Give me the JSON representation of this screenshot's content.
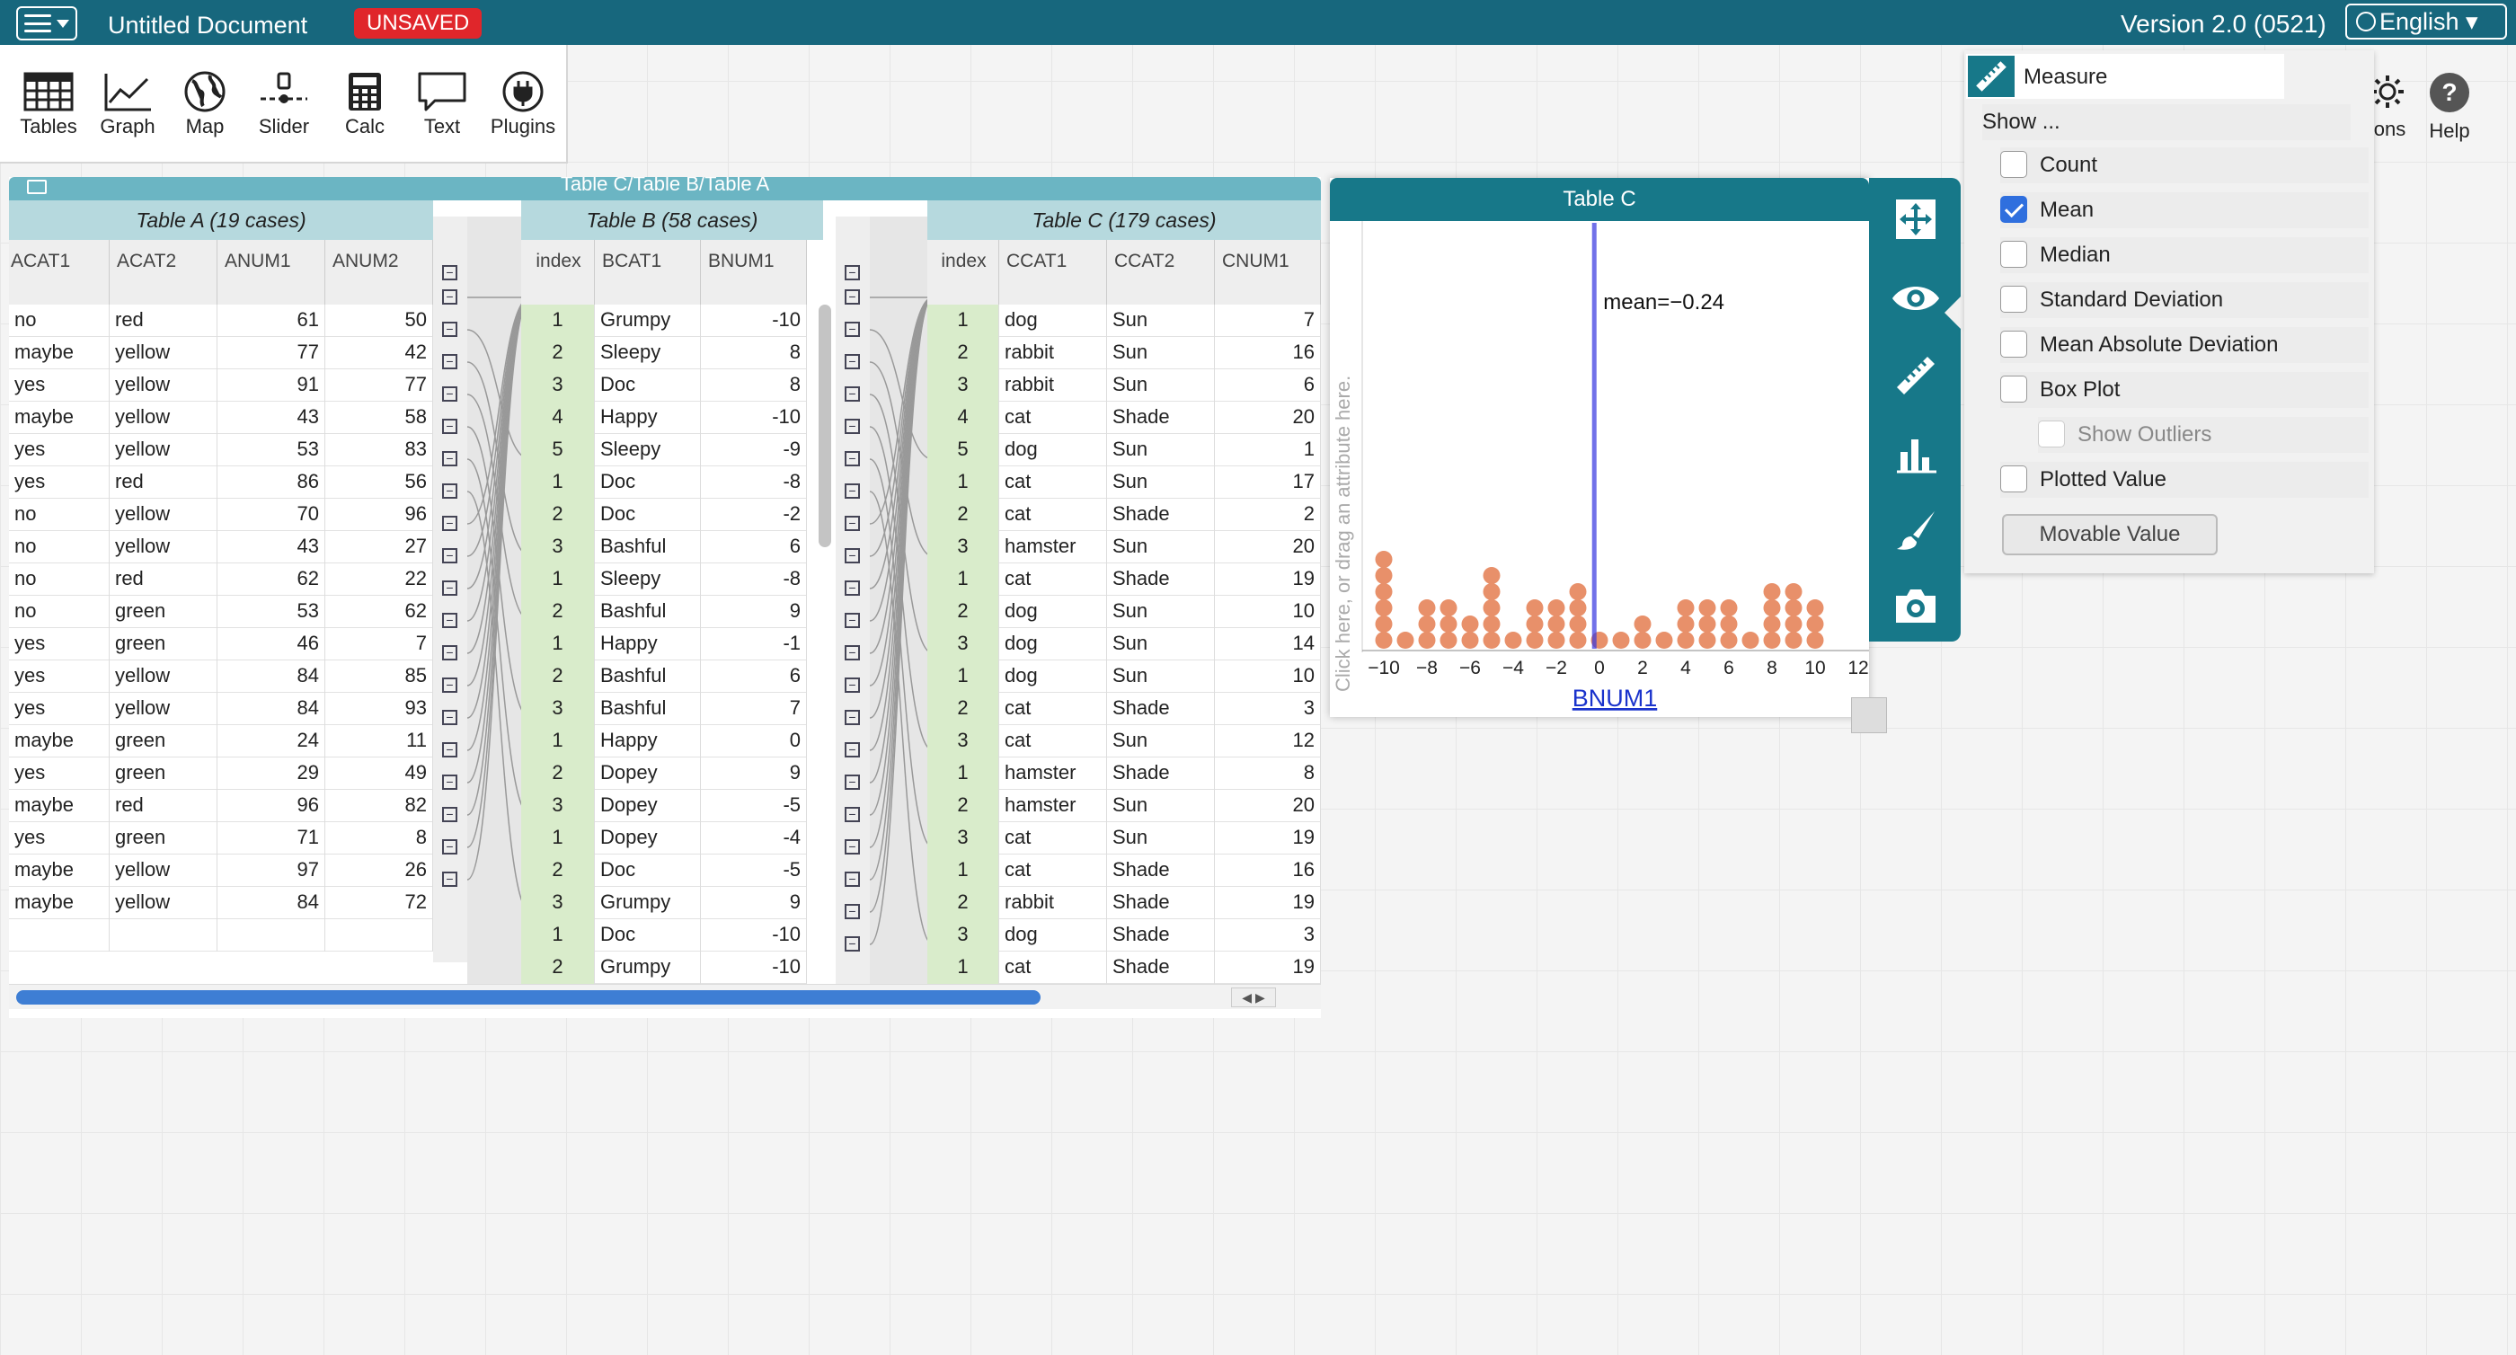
{
  "app": {
    "document_title": "Untitled Document",
    "unsaved_badge": "UNSAVED",
    "version": "Version 2.0 (0521)",
    "language": "English ▾"
  },
  "toolbar": {
    "tables": "Tables",
    "graph": "Graph",
    "map": "Map",
    "slider": "Slider",
    "calc": "Calc",
    "text": "Text",
    "plugins": "Plugins",
    "options": "tions",
    "help": "Help"
  },
  "tables": {
    "window_title": "Table C/Table B/Table A",
    "table_a": {
      "title": "Table A (19 cases)",
      "columns": [
        "ACAT1",
        "ACAT2",
        "ANUM1",
        "ANUM2"
      ],
      "rows": [
        [
          "no",
          "red",
          "61",
          "50"
        ],
        [
          "maybe",
          "yellow",
          "77",
          "42"
        ],
        [
          "yes",
          "yellow",
          "91",
          "77"
        ],
        [
          "maybe",
          "yellow",
          "43",
          "58"
        ],
        [
          "yes",
          "yellow",
          "53",
          "83"
        ],
        [
          "yes",
          "red",
          "86",
          "56"
        ],
        [
          "no",
          "yellow",
          "70",
          "96"
        ],
        [
          "no",
          "yellow",
          "43",
          "27"
        ],
        [
          "no",
          "red",
          "62",
          "22"
        ],
        [
          "no",
          "green",
          "53",
          "62"
        ],
        [
          "yes",
          "green",
          "46",
          "7"
        ],
        [
          "yes",
          "yellow",
          "84",
          "85"
        ],
        [
          "yes",
          "yellow",
          "84",
          "93"
        ],
        [
          "maybe",
          "green",
          "24",
          "11"
        ],
        [
          "yes",
          "green",
          "29",
          "49"
        ],
        [
          "maybe",
          "red",
          "96",
          "82"
        ],
        [
          "yes",
          "green",
          "71",
          "8"
        ],
        [
          "maybe",
          "yellow",
          "97",
          "26"
        ],
        [
          "maybe",
          "yellow",
          "84",
          "72"
        ]
      ]
    },
    "table_b": {
      "title": "Table B (58 cases)",
      "columns": [
        "index",
        "BCAT1",
        "BNUM1"
      ],
      "rows": [
        [
          "1",
          "Grumpy",
          "-10"
        ],
        [
          "2",
          "Sleepy",
          "8"
        ],
        [
          "3",
          "Doc",
          "8"
        ],
        [
          "4",
          "Happy",
          "-10"
        ],
        [
          "5",
          "Sleepy",
          "-9"
        ],
        [
          "1",
          "Doc",
          "-8"
        ],
        [
          "2",
          "Doc",
          "-2"
        ],
        [
          "3",
          "Bashful",
          "6"
        ],
        [
          "1",
          "Sleepy",
          "-8"
        ],
        [
          "2",
          "Bashful",
          "9"
        ],
        [
          "1",
          "Happy",
          "-1"
        ],
        [
          "2",
          "Bashful",
          "6"
        ],
        [
          "3",
          "Bashful",
          "7"
        ],
        [
          "1",
          "Happy",
          "0"
        ],
        [
          "2",
          "Dopey",
          "9"
        ],
        [
          "3",
          "Dopey",
          "-5"
        ],
        [
          "1",
          "Dopey",
          "-4"
        ],
        [
          "2",
          "Doc",
          "-5"
        ],
        [
          "3",
          "Grumpy",
          "9"
        ],
        [
          "1",
          "Doc",
          "-10"
        ],
        [
          "2",
          "Grumpy",
          "-10"
        ]
      ]
    },
    "table_c": {
      "title": "Table C (179 cases)",
      "columns": [
        "index",
        "CCAT1",
        "CCAT2",
        "CNUM1"
      ],
      "rows": [
        [
          "1",
          "dog",
          "Sun",
          "7"
        ],
        [
          "2",
          "rabbit",
          "Sun",
          "16"
        ],
        [
          "3",
          "rabbit",
          "Sun",
          "6"
        ],
        [
          "4",
          "cat",
          "Shade",
          "20"
        ],
        [
          "5",
          "dog",
          "Sun",
          "1"
        ],
        [
          "1",
          "cat",
          "Sun",
          "17"
        ],
        [
          "2",
          "cat",
          "Shade",
          "2"
        ],
        [
          "3",
          "hamster",
          "Sun",
          "20"
        ],
        [
          "1",
          "cat",
          "Shade",
          "19"
        ],
        [
          "2",
          "dog",
          "Sun",
          "10"
        ],
        [
          "3",
          "dog",
          "Sun",
          "14"
        ],
        [
          "1",
          "dog",
          "Sun",
          "10"
        ],
        [
          "2",
          "cat",
          "Shade",
          "3"
        ],
        [
          "3",
          "cat",
          "Sun",
          "12"
        ],
        [
          "1",
          "hamster",
          "Shade",
          "8"
        ],
        [
          "2",
          "hamster",
          "Sun",
          "20"
        ],
        [
          "3",
          "cat",
          "Sun",
          "19"
        ],
        [
          "1",
          "cat",
          "Shade",
          "16"
        ],
        [
          "2",
          "rabbit",
          "Shade",
          "19"
        ],
        [
          "3",
          "dog",
          "Shade",
          "3"
        ],
        [
          "1",
          "cat",
          "Shade",
          "19"
        ]
      ]
    }
  },
  "graph": {
    "title": "Table C",
    "y_drop_hint": "Click here, or drag an attribute here.",
    "x_attribute": "BNUM1",
    "mean_label": "mean=−0.24",
    "colors": {
      "point": "#e8906a",
      "mean_line": "#3535e0",
      "header": "#177889"
    },
    "chart_data": {
      "type": "scatter",
      "subtype": "dot-plot",
      "x_label": "BNUM1",
      "x_range": [
        -11,
        12.5
      ],
      "x_ticks": [
        "−10",
        "−8",
        "−6",
        "−4",
        "−2",
        "0",
        "2",
        "4",
        "6",
        "8",
        "10",
        "12"
      ],
      "x_tick_values": [
        -10,
        -8,
        -6,
        -4,
        -2,
        0,
        2,
        4,
        6,
        8,
        10,
        12
      ],
      "stacks": [
        {
          "x": -10,
          "count": 6
        },
        {
          "x": -9,
          "count": 1
        },
        {
          "x": -8,
          "count": 3
        },
        {
          "x": -7,
          "count": 3
        },
        {
          "x": -6,
          "count": 2
        },
        {
          "x": -5,
          "count": 5
        },
        {
          "x": -4,
          "count": 1
        },
        {
          "x": -3,
          "count": 3
        },
        {
          "x": -2,
          "count": 3
        },
        {
          "x": -1,
          "count": 4
        },
        {
          "x": 0,
          "count": 1
        },
        {
          "x": 1,
          "count": 1
        },
        {
          "x": 2,
          "count": 2
        },
        {
          "x": 3,
          "count": 1
        },
        {
          "x": 4,
          "count": 3
        },
        {
          "x": 5,
          "count": 3
        },
        {
          "x": 6,
          "count": 3
        },
        {
          "x": 7,
          "count": 1
        },
        {
          "x": 8,
          "count": 4
        },
        {
          "x": 9,
          "count": 4
        },
        {
          "x": 10,
          "count": 3
        }
      ],
      "mean": -0.24
    }
  },
  "measure": {
    "title": "Measure",
    "show_label": "Show ...",
    "items": [
      {
        "label": "Count",
        "checked": false
      },
      {
        "label": "Mean",
        "checked": true
      },
      {
        "label": "Median",
        "checked": false
      },
      {
        "label": "Standard Deviation",
        "checked": false
      },
      {
        "label": "Mean Absolute Deviation",
        "checked": false
      },
      {
        "label": "Box Plot",
        "checked": false
      },
      {
        "label": "Show Outliers",
        "checked": false,
        "disabled": true
      },
      {
        "label": "Plotted Value",
        "checked": false
      }
    ],
    "movable_value": "Movable Value"
  }
}
